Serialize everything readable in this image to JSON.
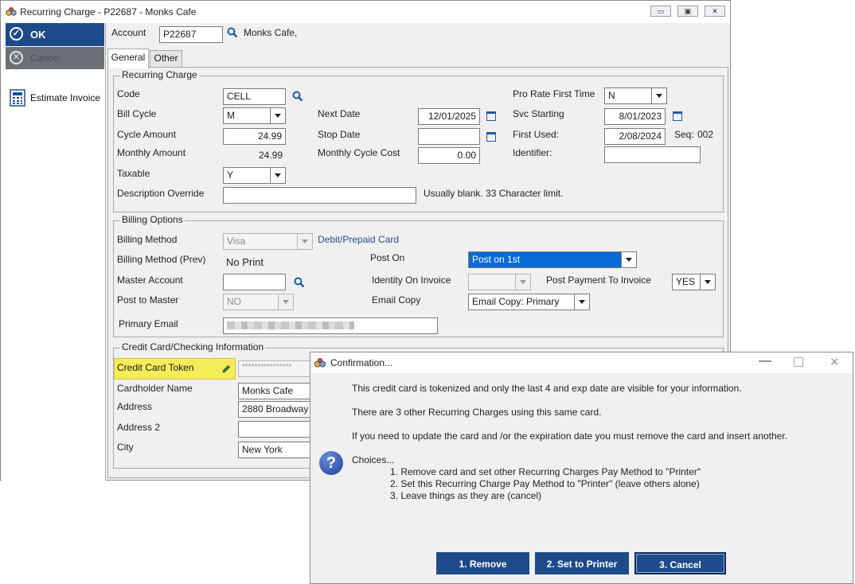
{
  "window": {
    "title": "Recurring Charge - P22687 - Monks Cafe"
  },
  "left_pane": {
    "ok_label": "OK",
    "cancel_label": "Cancel",
    "estimate_label": "Estimate Invoice"
  },
  "account": {
    "label": "Account",
    "value": "P22687",
    "name": "Monks Cafe,"
  },
  "tabs": [
    {
      "label": "General",
      "active": true
    },
    {
      "label": "Other",
      "active": false
    }
  ],
  "recurring": {
    "group_title": "Recurring Charge",
    "code_label": "Code",
    "code_value": "CELL",
    "bill_cycle_label": "Bill Cycle",
    "bill_cycle_value": "M",
    "cycle_amount_label": "Cycle Amount",
    "cycle_amount_value": "24.99",
    "monthly_amount_label": "Monthly Amount",
    "monthly_amount_value": "24.99",
    "taxable_label": "Taxable",
    "taxable_value": "Y",
    "desc_override_label": "Description Override",
    "desc_override_value": "",
    "desc_hint": "Usually blank. 33 Character limit.",
    "next_date_label": "Next Date",
    "next_date_value": "12/01/2025",
    "stop_date_label": "Stop Date",
    "stop_date_value": "",
    "monthly_cycle_cost_label": "Monthly Cycle Cost",
    "monthly_cycle_cost_value": "0.00",
    "pro_rate_label": "Pro Rate First Time",
    "pro_rate_value": "N",
    "svc_starting_label": "Svc Starting",
    "svc_starting_value": "8/01/2023",
    "first_used_label": "First Used:",
    "first_used_value": "2/08/2024",
    "seq_label": "Seq:",
    "seq_value": "002",
    "identifier_label": "Identifier:",
    "identifier_value": ""
  },
  "billing": {
    "group_title": "Billing Options",
    "method_label": "Billing Method",
    "method_value": "Visa",
    "method_link": "Debit/Prepaid Card",
    "method_prev_label": "Billing Method (Prev)",
    "method_prev_value": "No Print",
    "master_account_label": "Master Account",
    "master_account_value": "",
    "post_to_master_label": "Post to Master",
    "post_to_master_value": "NO",
    "primary_email_label": "Primary Email",
    "post_on_label": "Post On",
    "post_on_value": "Post on 1st",
    "identity_label": "Identity On Invoice",
    "identity_value": "",
    "email_copy_label": "Email Copy",
    "email_copy_value": "Email Copy: Primary",
    "post_payment_label": "Post Payment To Invoice",
    "post_payment_value": "YES"
  },
  "credit": {
    "group_title": "Credit Card/Checking Information",
    "token_label": "Credit Card Token",
    "token_value": "****************",
    "cardholder_label": "Cardholder Name",
    "cardholder_value": "Monks Cafe",
    "address_label": "Address",
    "address_value": "2880 Broadway",
    "address2_label": "Address 2",
    "address2_value": "",
    "city_label": "City",
    "city_value": "New York"
  },
  "dialog": {
    "title": "Confirmation...",
    "line1": "This credit card is tokenized and only the last 4 and exp date are visible for your information.",
    "line2": "There are 3 other Recurring Charges using this same card.",
    "line3": "If you need to update the card and /or the expiration date you must remove the card and insert another.",
    "choices_label": "Choices...",
    "choice1": "1. Remove card and set other Recurring Charges Pay Method to \"Printer\"",
    "choice2": "2. Set this Recurring Charge Pay Method to \"Printer\" (leave others alone)",
    "choice3": "3. Leave things as they are (cancel)",
    "btn_remove": "1. Remove",
    "btn_printer": "2. Set to Printer",
    "btn_cancel": "3. Cancel"
  },
  "colors": {
    "accent": "#1e4b8a",
    "selection": "#0a6ad8",
    "highlight": "#f5ec5a",
    "link": "#1f4e96"
  }
}
